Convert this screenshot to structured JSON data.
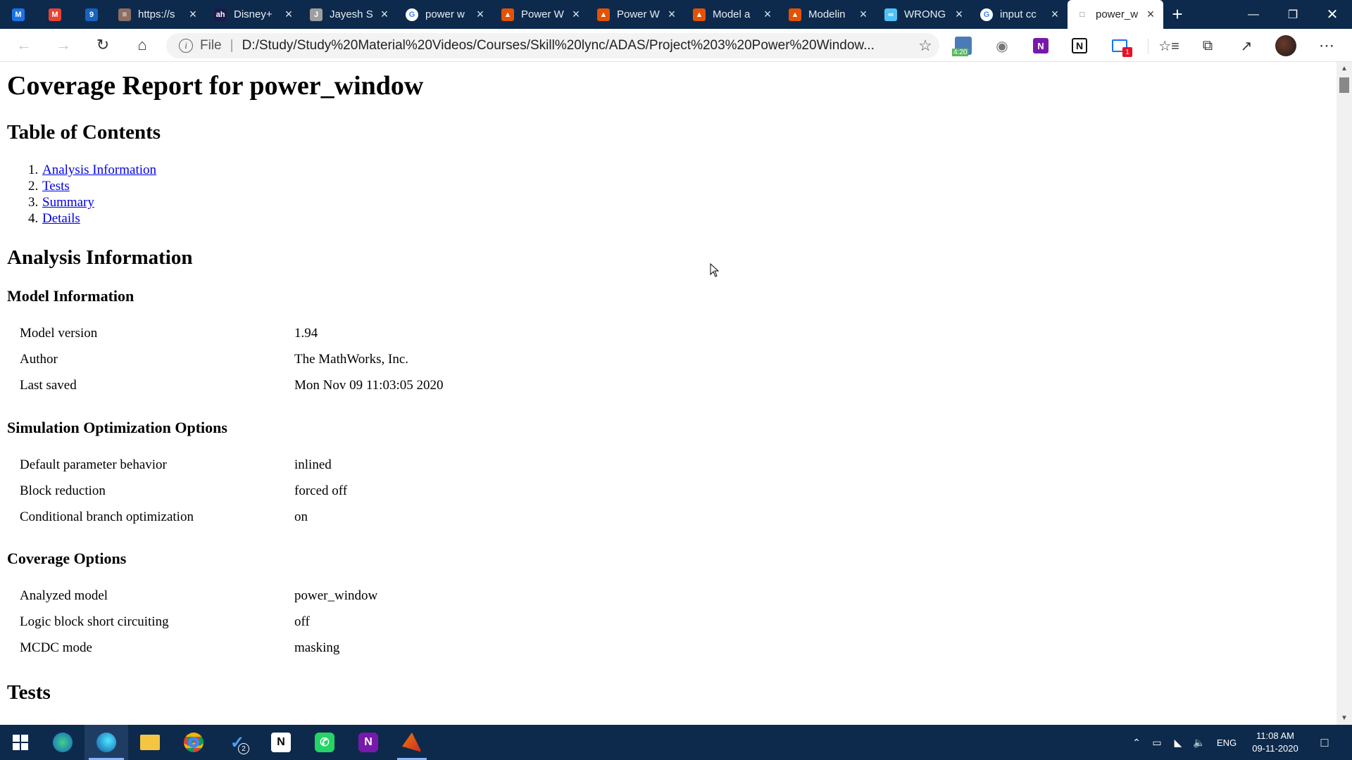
{
  "browser": {
    "tabs": [
      {
        "fav": "M",
        "color": "#1a73e8",
        "title": "",
        "pinned": true
      },
      {
        "fav": "M",
        "color": "#ea4335",
        "title": "",
        "pinned": true
      },
      {
        "fav": "9",
        "color": "#1565c0",
        "title": "",
        "pinned": true
      },
      {
        "fav": "≡",
        "color": "#8d6e63",
        "title": "https://s"
      },
      {
        "fav": "ah",
        "color": "#1b1b4b",
        "title": "Disney+"
      },
      {
        "fav": "J",
        "color": "#9e9e9e",
        "title": "Jayesh S"
      },
      {
        "fav": "G",
        "color": "#ffffff",
        "title": "power w"
      },
      {
        "fav": "▲",
        "color": "#e65100",
        "title": "Power W"
      },
      {
        "fav": "▲",
        "color": "#e65100",
        "title": "Power W"
      },
      {
        "fav": "▲",
        "color": "#e65100",
        "title": "Model a"
      },
      {
        "fav": "▲",
        "color": "#e65100",
        "title": "Modelin"
      },
      {
        "fav": "∞",
        "color": "#4fc3f7",
        "title": "WRONG"
      },
      {
        "fav": "G",
        "color": "#ffffff",
        "title": "input cc"
      },
      {
        "fav": "□",
        "color": "#ffffff",
        "title": "power_w",
        "active": true
      }
    ],
    "address": {
      "scheme_label": "File",
      "url": "D:/Study/Study%20Material%20Videos/Courses/Skill%20lync/ADAS/Project%203%20Power%20Window..."
    },
    "extension_badge": "4:20",
    "notif_badge": "1"
  },
  "page": {
    "title": "Coverage Report for power_window",
    "toc_heading": "Table of Contents",
    "toc": [
      {
        "num": "1.",
        "label": "Analysis Information"
      },
      {
        "num": "2.",
        "label": "Tests"
      },
      {
        "num": "3.",
        "label": "Summary"
      },
      {
        "num": "4.",
        "label": "Details"
      }
    ],
    "analysis_heading": "Analysis Information",
    "model_info": {
      "heading": "Model Information",
      "rows": [
        {
          "k": "Model version",
          "v": "1.94"
        },
        {
          "k": "Author",
          "v": "The MathWorks, Inc."
        },
        {
          "k": "Last saved",
          "v": "Mon Nov 09 11:03:05 2020"
        }
      ]
    },
    "sim_opts": {
      "heading": "Simulation Optimization Options",
      "rows": [
        {
          "k": "Default parameter behavior",
          "v": "inlined"
        },
        {
          "k": "Block reduction",
          "v": "forced off"
        },
        {
          "k": "Conditional branch optimization",
          "v": "on"
        }
      ]
    },
    "cov_opts": {
      "heading": "Coverage Options",
      "rows": [
        {
          "k": "Analyzed model",
          "v": "power_window"
        },
        {
          "k": "Logic block short circuiting",
          "v": "off"
        },
        {
          "k": "MCDC mode",
          "v": "masking"
        }
      ]
    },
    "tests_heading": "Tests"
  },
  "taskbar": {
    "todo_badge": "2",
    "lang": "ENG",
    "time": "11:08 AM",
    "date": "09-11-2020"
  }
}
